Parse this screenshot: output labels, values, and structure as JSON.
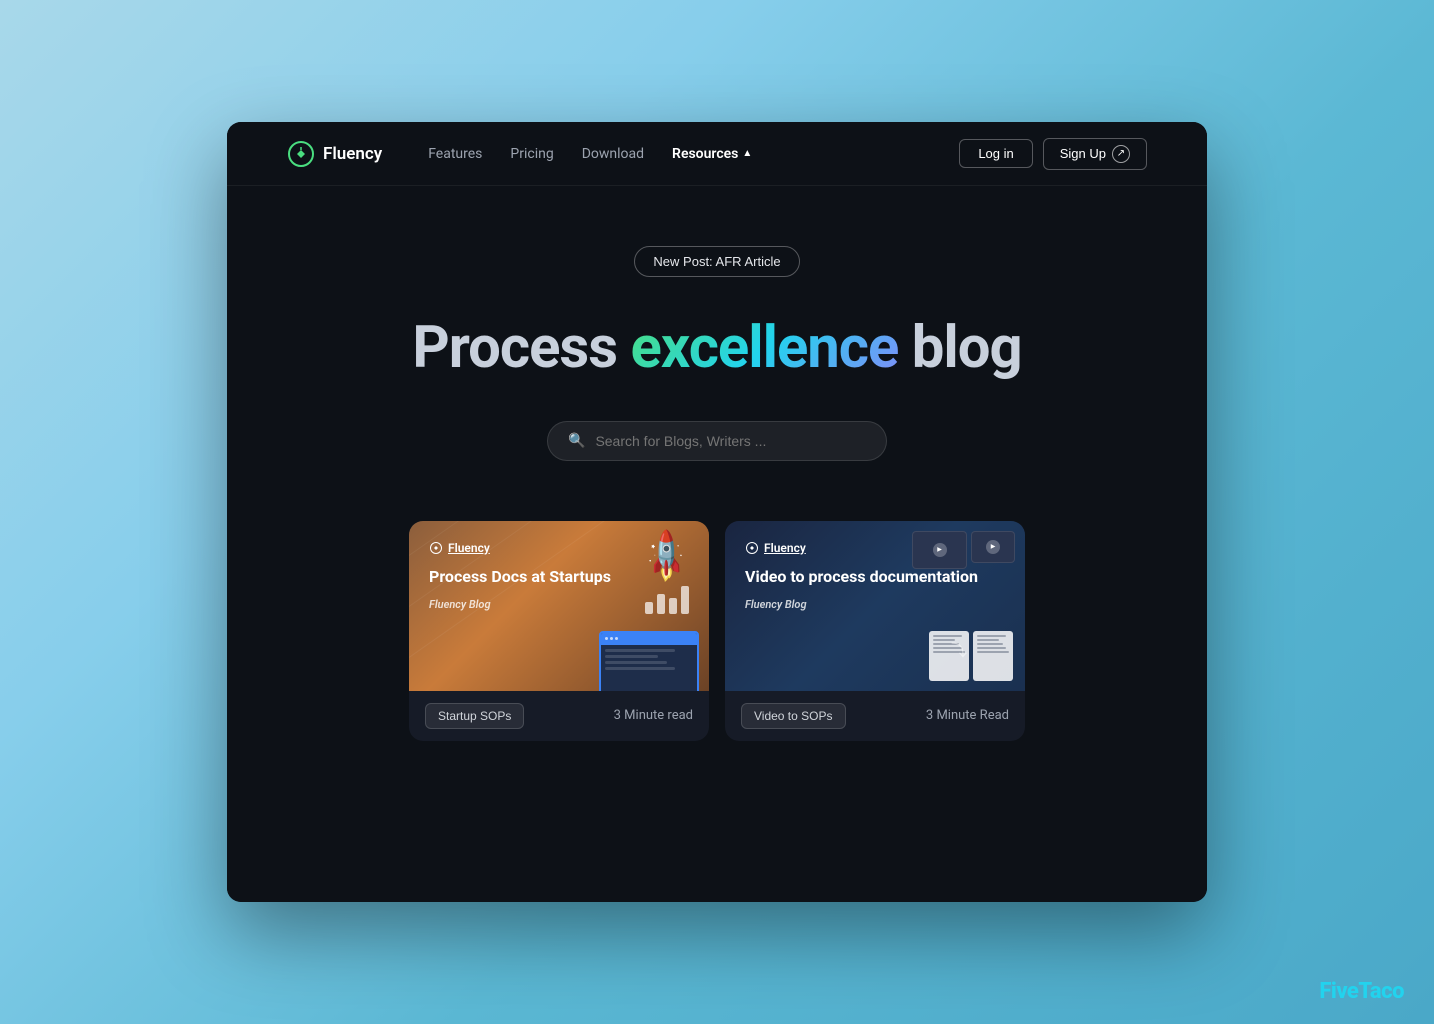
{
  "app": {
    "name": "Fluency"
  },
  "navbar": {
    "logo_text": "Fluency",
    "links": [
      {
        "label": "Features",
        "active": false
      },
      {
        "label": "Pricing",
        "active": false
      },
      {
        "label": "Download",
        "active": false
      },
      {
        "label": "Resources",
        "active": true,
        "has_dropdown": true
      }
    ],
    "login_label": "Log in",
    "signup_label": "Sign Up"
  },
  "hero": {
    "badge_text": "New Post: AFR Article",
    "title_part1": "Process ",
    "title_highlight": "excellence",
    "title_part2": " blog",
    "search_placeholder": "Search for Blogs, Writers ..."
  },
  "cards": [
    {
      "logo": "Fluency",
      "title": "Process Docs at Startups",
      "subtitle": "Fluency Blog",
      "tag": "Startup SOPs",
      "read_time": "3 Minute read"
    },
    {
      "logo": "Fluency",
      "title": "Video to process documentation",
      "subtitle": "Fluency Blog",
      "tag": "Video to SOPs",
      "read_time": "3 Minute Read"
    }
  ],
  "watermark": "FiveTaco"
}
